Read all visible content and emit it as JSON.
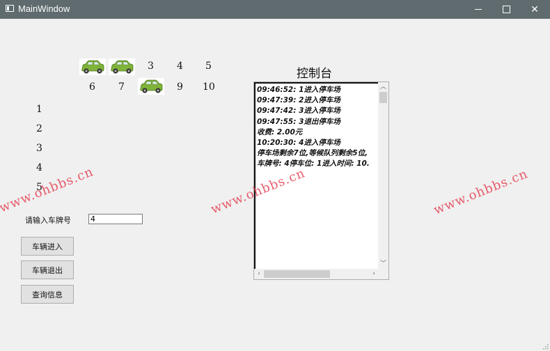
{
  "window": {
    "title": "MainWindow"
  },
  "slots_row1": [
    {
      "type": "car"
    },
    {
      "type": "car"
    },
    {
      "type": "number",
      "label": "3"
    },
    {
      "type": "number",
      "label": "4"
    },
    {
      "type": "number",
      "label": "5"
    }
  ],
  "slots_row2": [
    {
      "type": "number",
      "label": "6"
    },
    {
      "type": "number",
      "label": "7"
    },
    {
      "type": "car"
    },
    {
      "type": "number",
      "label": "9"
    },
    {
      "type": "number",
      "label": "10"
    }
  ],
  "queue": [
    "1",
    "2",
    "3",
    "4",
    "5"
  ],
  "plate_input": {
    "label": "请输入车牌号",
    "value": "4"
  },
  "buttons": {
    "enter": "车辆进入",
    "exit": "车辆退出",
    "query": "查询信息"
  },
  "console": {
    "title": "控制台",
    "lines": [
      "09:46:52: 1进入停车场",
      "09:47:39: 2进入停车场",
      "09:47:42: 3进入停车场",
      "09:47:55: 3退出停车场",
      "收费: 2.00元",
      "10:20:30: 4进入停车场",
      "停车场剩余7位,等候队列剩余5位,",
      "车牌号: 4停车位: 1进入时间: 10."
    ]
  },
  "watermark": "www.ohbbs.cn",
  "colors": {
    "titlebar": "#5f6b6e",
    "car_body": "#7fb33a",
    "watermark": "#e1283c"
  }
}
